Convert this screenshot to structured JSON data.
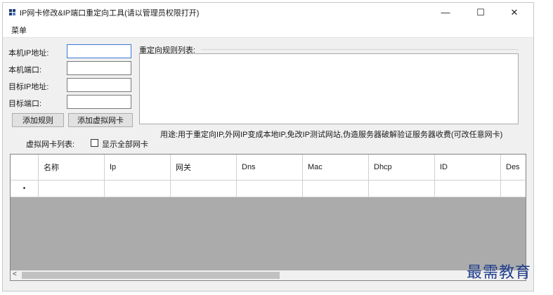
{
  "window": {
    "title": "IP网卡修改&IP端口重定向工具(请以管理员权限打开)",
    "minimize": "—",
    "maximize": "☐",
    "close": "✕"
  },
  "menu": {
    "label": "菜单"
  },
  "form": {
    "local_ip_label": "本机IP地址:",
    "local_port_label": "本机端口:",
    "target_ip_label": "目标IP地址:",
    "target_port_label": "目标端口:",
    "local_ip_value": "",
    "local_port_value": "",
    "target_ip_value": "",
    "target_port_value": "",
    "add_rule_button": "添加规则",
    "add_virtual_nic_button": "添加虚拟网卡"
  },
  "redirect": {
    "list_label": "重定向规则列表:",
    "usage_text": "用途:用于重定向IP,外网IP变成本地IP,免改IP测试网站,伪造服务器破解验证服务器收费(可改任意网卡)"
  },
  "nic_list": {
    "label": "虚拟网卡列表:",
    "show_all_label": "显示全部网卡",
    "show_all_checked": false
  },
  "grid": {
    "columns": [
      "名称",
      "Ip",
      "网关",
      "Dns",
      "Mac",
      "Dhcp",
      "ID",
      "Des"
    ],
    "new_row_marker": "•"
  },
  "scrollbar": {
    "left_arrow": "<"
  },
  "watermark": {
    "text": "最需教育"
  }
}
